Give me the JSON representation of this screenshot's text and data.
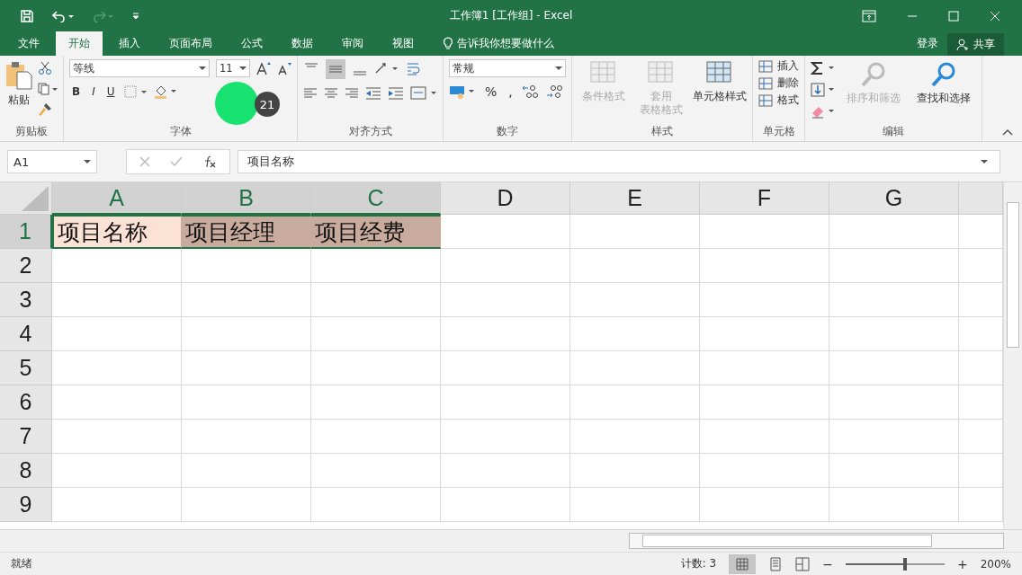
{
  "window": {
    "title": "工作簿1  [工作组] - Excel"
  },
  "tabs": [
    {
      "label": "文件",
      "selected": false
    },
    {
      "label": "开始",
      "selected": true
    },
    {
      "label": "插入",
      "selected": false
    },
    {
      "label": "页面布局",
      "selected": false
    },
    {
      "label": "公式",
      "selected": false
    },
    {
      "label": "数据",
      "selected": false
    },
    {
      "label": "审阅",
      "selected": false
    },
    {
      "label": "视图",
      "selected": false
    }
  ],
  "tell_me": "告诉我你想要做什么",
  "sign_in": "登录",
  "share": "共享",
  "ribbon": {
    "clipboard": {
      "paste": "粘贴",
      "label": "剪贴板"
    },
    "font": {
      "name": "等线",
      "size": "11",
      "label": "字体",
      "bold": "B",
      "italic": "I",
      "underline": "U"
    },
    "alignment": {
      "label": "对齐方式"
    },
    "number": {
      "format": "常规",
      "percent": "%",
      "comma": ",",
      "label": "数字"
    },
    "styles": {
      "label": "样式",
      "items": [
        {
          "lines": [
            "条件格式"
          ],
          "disabled": true
        },
        {
          "lines": [
            "套用",
            "表格格式"
          ],
          "disabled": true
        },
        {
          "lines": [
            "单元格样式"
          ],
          "disabled": false
        }
      ]
    },
    "cells": {
      "label": "单元格",
      "items": [
        "插入",
        "删除",
        "格式"
      ]
    },
    "editing": {
      "label": "编辑",
      "items": [
        {
          "label": "排序和筛选",
          "disabled": true
        },
        {
          "label": "查找和选择",
          "disabled": false
        }
      ]
    }
  },
  "click_marker": {
    "step": "21"
  },
  "name_box": "A1",
  "formula": "项目名称",
  "columns": [
    {
      "label": "A",
      "selected": true
    },
    {
      "label": "B",
      "selected": true
    },
    {
      "label": "C",
      "selected": true
    },
    {
      "label": "D",
      "selected": false
    },
    {
      "label": "E",
      "selected": false
    },
    {
      "label": "F",
      "selected": false
    },
    {
      "label": "G",
      "selected": false
    }
  ],
  "rows": [
    {
      "label": "1",
      "selected": true,
      "cells": [
        {
          "text": "项目名称",
          "selected": true,
          "active": true
        },
        {
          "text": "项目经理",
          "selected": true,
          "active": false
        },
        {
          "text": "项目经费",
          "selected": true,
          "active": false
        }
      ]
    },
    {
      "label": "2",
      "selected": false,
      "cells": []
    },
    {
      "label": "3",
      "selected": false,
      "cells": []
    },
    {
      "label": "4",
      "selected": false,
      "cells": []
    },
    {
      "label": "5",
      "selected": false,
      "cells": []
    },
    {
      "label": "6",
      "selected": false,
      "cells": []
    },
    {
      "label": "7",
      "selected": false,
      "cells": []
    },
    {
      "label": "8",
      "selected": false,
      "cells": []
    },
    {
      "label": "9",
      "selected": false,
      "cells": []
    }
  ],
  "status_bar": {
    "ready": "就绪",
    "count": "计数: 3",
    "zoom": "200%",
    "zoom_out": "−",
    "zoom_in": "+",
    "zoom_level": {
      "level": 0.6
    }
  }
}
